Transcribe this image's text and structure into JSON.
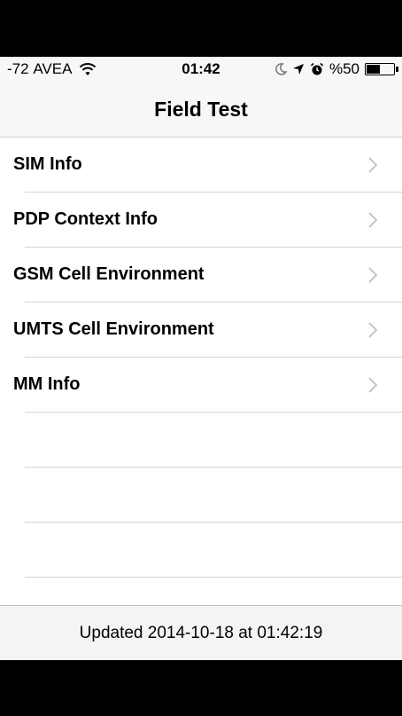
{
  "status_bar": {
    "signal": "-72",
    "carrier": "AVEA",
    "time": "01:42",
    "battery_percent": "%50",
    "battery_level": 0.5,
    "icons": [
      "wifi-icon",
      "moon-icon",
      "location-arrow-icon",
      "alarm-icon",
      "battery-icon"
    ]
  },
  "nav": {
    "title": "Field Test"
  },
  "items": [
    {
      "label": "SIM Info"
    },
    {
      "label": "PDP Context Info"
    },
    {
      "label": "GSM Cell Environment"
    },
    {
      "label": "UMTS Cell Environment"
    },
    {
      "label": "MM Info"
    }
  ],
  "footer": {
    "updated_text": "Updated 2014-10-18 at 01:42:19"
  },
  "colors": {
    "bar_bg": "#f7f7f7",
    "separator": "#d4d4d4",
    "chevron": "#c7c7cc"
  }
}
